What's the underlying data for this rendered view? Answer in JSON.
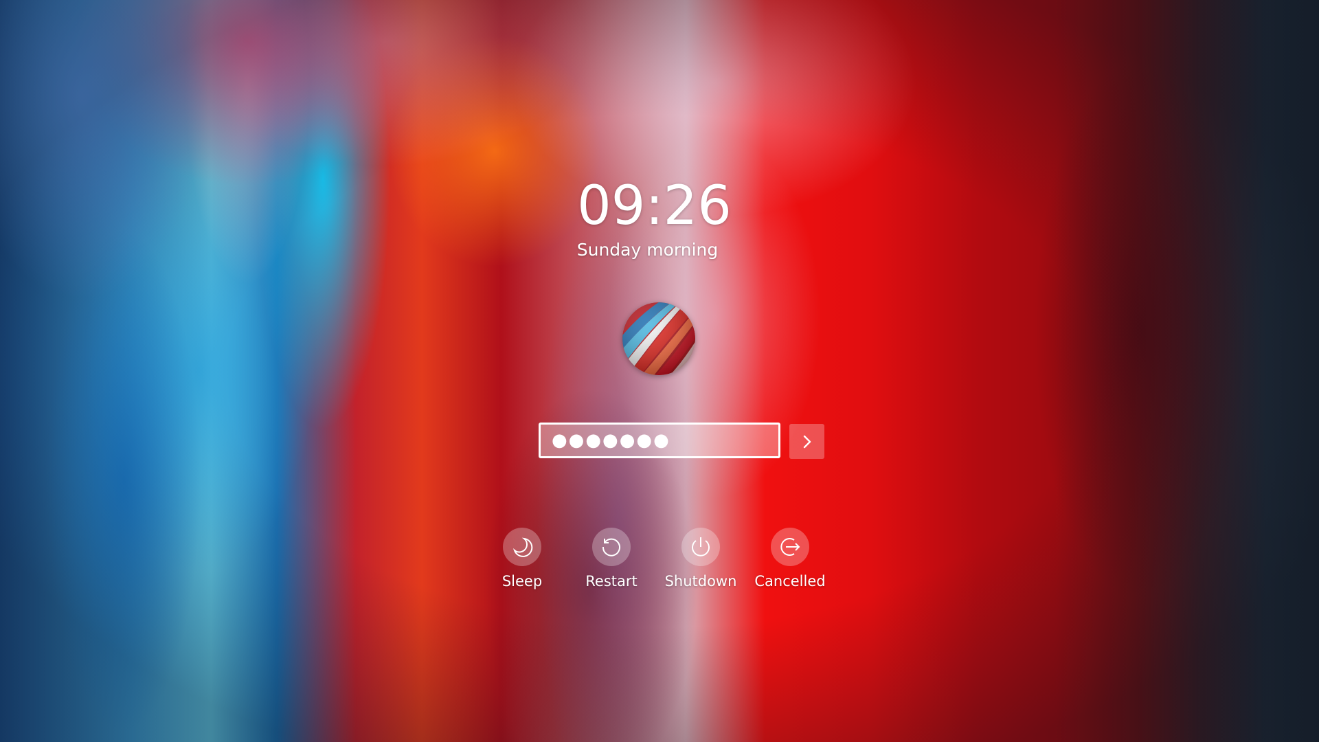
{
  "lock_screen": {
    "clock": "09:26",
    "date_text": "Sunday morning",
    "password": {
      "masked_value": "●●●●●●●",
      "placeholder": ""
    },
    "submit_icon": "chevron-right-icon",
    "actions": [
      {
        "label": "Sleep",
        "icon": "moon-icon"
      },
      {
        "label": "Restart",
        "icon": "restart-icon"
      },
      {
        "label": "Shutdown",
        "icon": "power-icon"
      },
      {
        "label": "Cancelled",
        "icon": "logout-icon"
      }
    ]
  },
  "colors": {
    "accent": "#e00e10",
    "text": "#ffffff"
  }
}
